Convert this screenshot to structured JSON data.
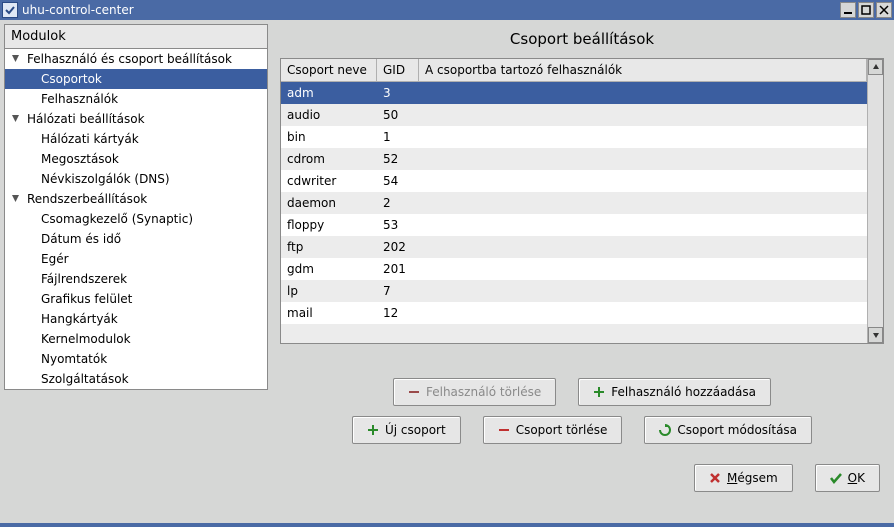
{
  "window_title": "uhu-control-center",
  "sidebar": {
    "header": "Modulok",
    "groups": [
      {
        "label": "Felhasználó és csoport beállítások",
        "items": [
          {
            "label": "Csoportok",
            "selected": true
          },
          {
            "label": "Felhasználók"
          }
        ]
      },
      {
        "label": "Hálózati beállítások",
        "items": [
          {
            "label": "Hálózati kártyák"
          },
          {
            "label": "Megosztások"
          },
          {
            "label": "Névkiszolgálók (DNS)"
          }
        ]
      },
      {
        "label": "Rendszerbeállítások",
        "items": [
          {
            "label": "Csomagkezelő (Synaptic)"
          },
          {
            "label": "Dátum és idő"
          },
          {
            "label": "Egér"
          },
          {
            "label": "Fájlrendszerek"
          },
          {
            "label": "Grafikus felület"
          },
          {
            "label": "Hangkártyák"
          },
          {
            "label": "Kernelmodulok"
          },
          {
            "label": "Nyomtatók"
          },
          {
            "label": "Szolgáltatások"
          }
        ]
      }
    ]
  },
  "main": {
    "title": "Csoport beállítások",
    "columns": {
      "name": "Csoport neve",
      "gid": "GID",
      "users": "A csoportba tartozó felhasználók"
    },
    "rows": [
      {
        "name": "adm",
        "gid": "3",
        "users": "",
        "selected": true
      },
      {
        "name": "audio",
        "gid": "50",
        "users": ""
      },
      {
        "name": "bin",
        "gid": "1",
        "users": ""
      },
      {
        "name": "cdrom",
        "gid": "52",
        "users": ""
      },
      {
        "name": "cdwriter",
        "gid": "54",
        "users": ""
      },
      {
        "name": "daemon",
        "gid": "2",
        "users": ""
      },
      {
        "name": "floppy",
        "gid": "53",
        "users": ""
      },
      {
        "name": "ftp",
        "gid": "202",
        "users": ""
      },
      {
        "name": "gdm",
        "gid": "201",
        "users": ""
      },
      {
        "name": "lp",
        "gid": "7",
        "users": ""
      },
      {
        "name": "mail",
        "gid": "12",
        "users": ""
      }
    ]
  },
  "buttons": {
    "del_user": "Felhasználó törlése",
    "add_user": "Felhasználó hozzáadása",
    "new_group": "Új csoport",
    "del_group": "Csoport törlése",
    "mod_group": "Csoport módosítása",
    "cancel_u": "M",
    "cancel_rest": "égsem",
    "ok_u": "O",
    "ok_rest": "K"
  }
}
